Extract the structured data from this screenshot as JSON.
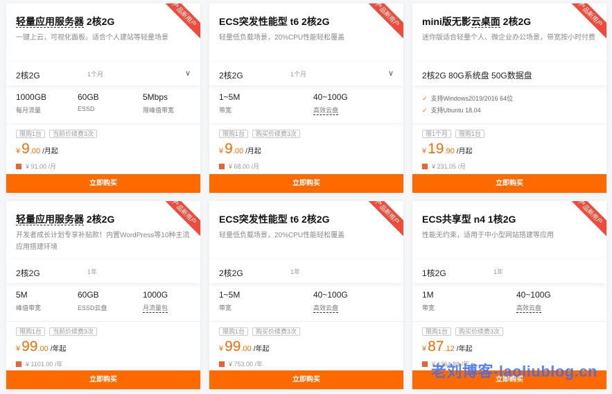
{
  "ribbon_label": "产品新用户",
  "buy_label": "立即购买",
  "check_icon": "check-icon",
  "colors": {
    "accent": "#ff6a00",
    "ribbon": "#f04b3a",
    "watermark": "#3d6df2"
  },
  "cards": [
    {
      "title": [
        {
          "text": "轻量应用服务器",
          "dashed": true
        },
        {
          "text": " 2核2G",
          "dashed": false
        }
      ],
      "desc": "一键上云，可视化面板。适合个人建站等轻量场景",
      "band": {
        "spec": "2核2G",
        "period": "1个月",
        "dropdown": true
      },
      "specs": [
        {
          "value": "1000GB",
          "label": "每月流量"
        },
        {
          "value": "60GB",
          "label": "ESSD"
        },
        {
          "value": "5Mbps",
          "label": "限峰值带宽"
        }
      ],
      "tags": [
        "限购1台",
        "当前价续费3次"
      ],
      "price": {
        "currency": "¥",
        "int": "9",
        "dec": ".00",
        "unit": "/月起"
      },
      "original": "¥ 91.00 /月"
    },
    {
      "title": [
        {
          "text": "ECS突发性能型 t6 2核2G",
          "dashed": false
        }
      ],
      "desc": "轻量低负载场景，20%CPU性能轻松覆盖",
      "band": {
        "spec": "2核2G",
        "period": "1个月",
        "dropdown": true
      },
      "specs": [
        {
          "value": "1~5M",
          "label": "带宽"
        },
        {
          "value": "40~100G",
          "label": "高效云盘",
          "dashed": true
        }
      ],
      "tags": [
        "限购1台",
        "购买价续费3次"
      ],
      "price": {
        "currency": "¥",
        "int": "9",
        "dec": ".00",
        "unit": "/月起"
      },
      "original": "¥ 68.00 /月"
    },
    {
      "title": [
        {
          "text": "mini版无影",
          "dashed": false
        },
        {
          "text": "云桌面",
          "dashed": true
        },
        {
          "text": " 2核2G",
          "dashed": false
        }
      ],
      "desc": "迷你版适合轻量个人、微企业办公场景，带宽按小时付费",
      "band": {
        "spec": "2核2G 80G系统盘 50G数据盘",
        "period": "",
        "dropdown": false
      },
      "features": [
        "支持Windows2019/2016 64位",
        "支持Ubuntu 18.04"
      ],
      "tags": [
        "限1个月",
        "限购1台"
      ],
      "price": {
        "currency": "¥",
        "int": "19",
        "dec": ".90",
        "unit": "/月起"
      },
      "original": "¥ 231.05 /月"
    },
    {
      "title": [
        {
          "text": "轻量应用服务器",
          "dashed": true
        },
        {
          "text": " 2核2G",
          "dashed": false
        }
      ],
      "desc": "开发者成长计划专享补贴款！内置WordPress等10种主流应用搭建环境",
      "band": {
        "spec": "2核2G",
        "period": "1年",
        "dropdown": false
      },
      "specs": [
        {
          "value": "5M",
          "label": "峰值带宽"
        },
        {
          "value": "60GB",
          "label": "ESSD云盘"
        },
        {
          "value": "1000G",
          "label": "月流量包",
          "dashed": true
        }
      ],
      "tags": [
        "限购1台",
        "当前价续费3次"
      ],
      "price": {
        "currency": "¥",
        "int": "99",
        "dec": ".00",
        "unit": "/年起"
      },
      "original": "¥ 1101.00 /年"
    },
    {
      "title": [
        {
          "text": "ECS突发性能型 t6 2核2G",
          "dashed": false
        }
      ],
      "desc": "轻量低负载场景，20%CPU性能轻松覆盖",
      "band": {
        "spec": "2核2G",
        "period": "1年",
        "dropdown": false
      },
      "specs": [
        {
          "value": "1~5M",
          "label": "带宽"
        },
        {
          "value": "40~100G",
          "label": "高效云盘",
          "dashed": true
        }
      ],
      "tags": [
        "限购1台",
        "购买价续费3次"
      ],
      "price": {
        "currency": "¥",
        "int": "99",
        "dec": ".00",
        "unit": "/年起"
      },
      "original": "¥ 753.00 /年"
    },
    {
      "title": [
        {
          "text": "ECS共享型 n4 1核2G",
          "dashed": false
        }
      ],
      "desc": "性能无约束，适用于中小型网站搭建等应用",
      "band": {
        "spec": "1核2G",
        "period": "1年",
        "dropdown": false
      },
      "specs": [
        {
          "value": "1M",
          "label": "带宽"
        },
        {
          "value": "40~100G",
          "label": "高效云盘",
          "dashed": true
        }
      ],
      "tags": [
        "限购1台",
        "购买价续费3次"
      ],
      "price": {
        "currency": "¥",
        "int": "87",
        "dec": ".12",
        "unit": "/年起"
      },
      "original": "¥ 1364.88 /年"
    }
  ],
  "watermark": "老刘博客-laoliublog.cn"
}
